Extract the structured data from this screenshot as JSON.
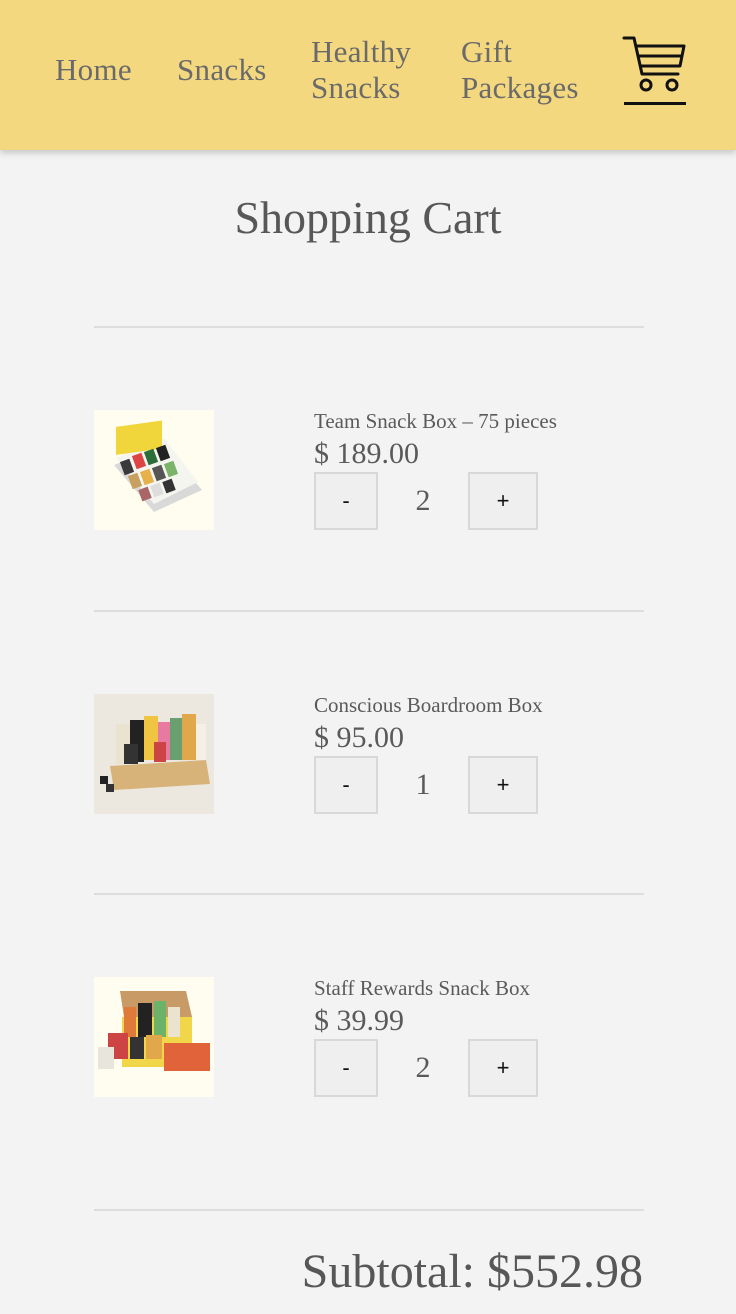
{
  "nav": {
    "home": "Home",
    "snacks": "Snacks",
    "healthy_snacks": "Healthy Snacks",
    "gift_packages": "Gift Packages",
    "cart_icon": "shopping-cart-icon"
  },
  "page": {
    "title": "Shopping Cart"
  },
  "cart": {
    "items": [
      {
        "name": "Team Snack Box – 75 pieces",
        "price": "$ 189.00",
        "quantity": "2",
        "minus": "-",
        "plus": "+"
      },
      {
        "name": "Conscious Boardroom Box",
        "price": "$ 95.00",
        "quantity": "1",
        "minus": "-",
        "plus": "+"
      },
      {
        "name": "Staff Rewards Snack Box",
        "price": "$ 39.99",
        "quantity": "2",
        "minus": "-",
        "plus": "+"
      }
    ],
    "subtotal": "Subtotal: $552.98"
  },
  "colors": {
    "header_bg": "#f3d87f",
    "page_bg": "#f3f3f3",
    "text": "#5a5a5a",
    "button_bg": "#efefef"
  }
}
